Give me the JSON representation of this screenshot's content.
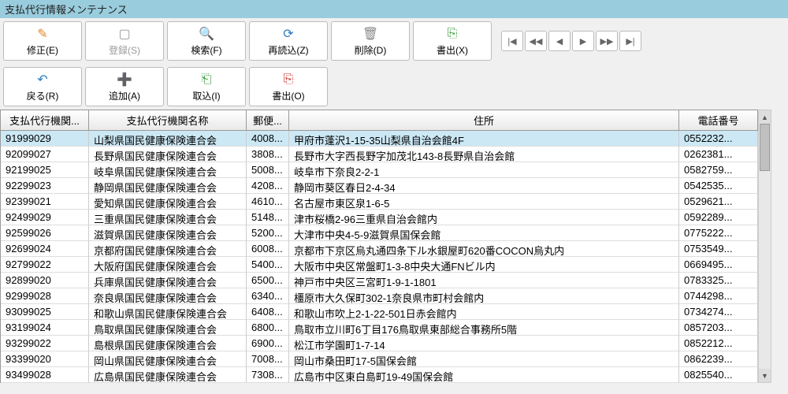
{
  "title": "支払代行情報メンテナンス",
  "toolbar": {
    "edit": "修正(E)",
    "save": "登録(S)",
    "search": "検索(F)",
    "reload": "再読込(Z)",
    "delete": "削除(D)",
    "export": "書出(X)",
    "back": "戻る(R)",
    "add": "追加(A)",
    "import": "取込(I)",
    "export2": "書出(O)"
  },
  "columns": {
    "code": "支払代行機関...",
    "name": "支払代行機関名称",
    "post": "郵便...",
    "addr": "住所",
    "tel": "電話番号"
  },
  "rows": [
    {
      "code": "91999029",
      "name": "山梨県国民健康保険連合会",
      "post": "4008...",
      "addr": "甲府市蓬沢1-15-35山梨県自治会館4F",
      "tel": "0552232..."
    },
    {
      "code": "92099027",
      "name": "長野県国民健康保険連合会",
      "post": "3808...",
      "addr": "長野市大字西長野字加茂北143-8長野県自治会館",
      "tel": "0262381..."
    },
    {
      "code": "92199025",
      "name": "岐阜県国民健康保険連合会",
      "post": "5008...",
      "addr": "岐阜市下奈良2-2-1",
      "tel": "0582759..."
    },
    {
      "code": "92299023",
      "name": "静岡県国民健康保険連合会",
      "post": "4208...",
      "addr": "静岡市葵区春日2-4-34",
      "tel": "0542535..."
    },
    {
      "code": "92399021",
      "name": "愛知県国民健康保険連合会",
      "post": "4610...",
      "addr": "名古屋市東区泉1-6-5",
      "tel": "0529621..."
    },
    {
      "code": "92499029",
      "name": "三重県国民健康保険連合会",
      "post": "5148...",
      "addr": "津市桜橋2-96三重県自治会館内",
      "tel": "0592289..."
    },
    {
      "code": "92599026",
      "name": "滋賀県国民健康保険連合会",
      "post": "5200...",
      "addr": "大津市中央4-5-9滋賀県国保会館",
      "tel": "0775222..."
    },
    {
      "code": "92699024",
      "name": "京都府国民健康保険連合会",
      "post": "6008...",
      "addr": "京都市下京区烏丸通四条下ル水銀屋町620番COCON烏丸内",
      "tel": "0753549..."
    },
    {
      "code": "92799022",
      "name": "大阪府国民健康保険連合会",
      "post": "5400...",
      "addr": "大阪市中央区常盤町1-3-8中央大通FNビル内",
      "tel": "0669495..."
    },
    {
      "code": "92899020",
      "name": "兵庫県国民健康保険連合会",
      "post": "6500...",
      "addr": "神戸市中央区三宮町1-9-1-1801",
      "tel": "0783325..."
    },
    {
      "code": "92999028",
      "name": "奈良県国民健康保険連合会",
      "post": "6340...",
      "addr": "橿原市大久保町302-1奈良県市町村会館内",
      "tel": "0744298..."
    },
    {
      "code": "93099025",
      "name": "和歌山県国民健康保険連合会",
      "post": "6408...",
      "addr": "和歌山市吹上2-1-22-501日赤会館内",
      "tel": "0734274..."
    },
    {
      "code": "93199024",
      "name": "鳥取県国民健康保険連合会",
      "post": "6800...",
      "addr": "鳥取市立川町6丁目176鳥取県東部総合事務所5階",
      "tel": "0857203..."
    },
    {
      "code": "93299022",
      "name": "島根県国民健康保険連合会",
      "post": "6900...",
      "addr": "松江市学園町1-7-14",
      "tel": "0852212..."
    },
    {
      "code": "93399020",
      "name": "岡山県国民健康保険連合会",
      "post": "7008...",
      "addr": "岡山市桑田町17-5国保会館",
      "tel": "0862239..."
    },
    {
      "code": "93499028",
      "name": "広島県国民健康保険連合会",
      "post": "7308...",
      "addr": "広島市中区東白島町19-49国保会館",
      "tel": "0825540..."
    }
  ],
  "chart_data": null
}
